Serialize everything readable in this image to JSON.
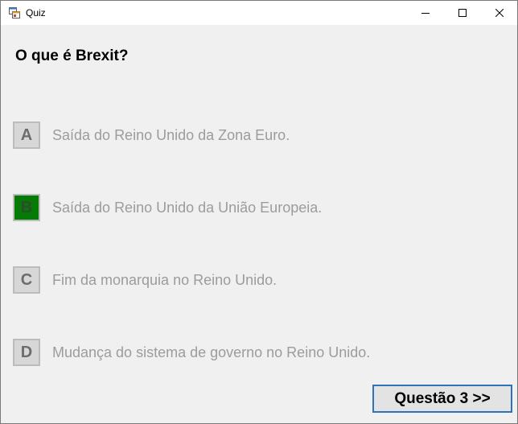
{
  "window": {
    "title": "Quiz",
    "app_icon": "winforms-app-icon",
    "controls": [
      "minimize-icon",
      "maximize-icon",
      "close-icon"
    ]
  },
  "quiz": {
    "question": "O que é Brexit?",
    "options": [
      {
        "letter": "A",
        "text": "Saída do Reino Unido da Zona Euro.",
        "selected": false
      },
      {
        "letter": "B",
        "text": "Saída do Reino Unido da União Europeia.",
        "selected": true
      },
      {
        "letter": "C",
        "text": "Fim da monarquia no Reino Unido.",
        "selected": false
      },
      {
        "letter": "D",
        "text": "Mudança do sistema de governo no Reino Unido.",
        "selected": false
      }
    ],
    "next_label": "Questão 3 >>"
  },
  "colors": {
    "selected_answer": "#037b05",
    "option_text": "#9c9c9c",
    "next_button_border": "#2e73b8"
  }
}
